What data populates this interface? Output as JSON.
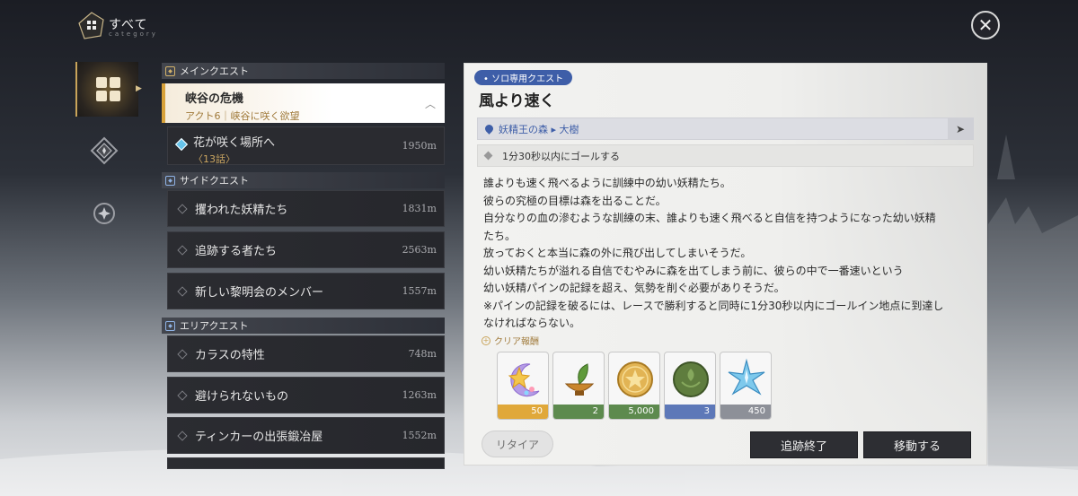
{
  "header": {
    "title": "すべて",
    "subtitle": "category"
  },
  "colors": {
    "accent_gold": "#d8a23a",
    "solo_blue": "#3e5ea8",
    "panel_bg": "#f2f2f0",
    "row_dark": "#2b2c31"
  },
  "sections": {
    "main": {
      "label": "メインクエスト"
    },
    "side": {
      "label": "サイドクエスト"
    },
    "area": {
      "label": "エリアクエスト"
    }
  },
  "main_quest": {
    "title": "峡谷の危機",
    "subtitle": "アクト6｜峡谷に咲く欲望"
  },
  "sub_quest": {
    "title": "花が咲く場所へ",
    "chapter": "〈13話〉",
    "distance": "1950m"
  },
  "side_quests": [
    {
      "title": "攫われた妖精たち",
      "distance": "1831m"
    },
    {
      "title": "追跡する者たち",
      "distance": "2563m"
    },
    {
      "title": "新しい黎明会のメンバー",
      "distance": "1557m"
    }
  ],
  "area_quests": [
    {
      "title": "カラスの特性",
      "distance": "748m"
    },
    {
      "title": "避けられないもの",
      "distance": "1263m"
    },
    {
      "title": "ティンカーの出張鍛冶屋",
      "distance": "1552m"
    }
  ],
  "detail": {
    "badge": "• ソロ専用クエスト",
    "title": "風より速く",
    "location": "妖精王の森 ▸ 大樹",
    "objective": "1分30秒以内にゴールする",
    "description": [
      "誰よりも速く飛べるように訓練中の幼い妖精たち。",
      "彼らの究極の目標は森を出ることだ。",
      "自分なりの血の滲むような訓練の末、誰よりも速く飛べると自信を持つようになった幼い妖精",
      "たち。",
      "放っておくと本当に森の外に飛び出してしまいそうだ。",
      "幼い妖精たちが溢れる自信でむやみに森を出てしまう前に、彼らの中で一番速いという",
      "幼い妖精パインの記録を超え、気勢を削ぐ必要がありそうだ。",
      "※パインの記録を破るには、レースで勝利すると同時に1分30秒以内にゴールイン地点に到達し",
      "なければならない。"
    ],
    "reward_label": "クリア報酬",
    "rewards": [
      {
        "icon": "moon-star-icon",
        "count": "50",
        "tier_color": "#e0a83a"
      },
      {
        "icon": "sprout-bowl-icon",
        "count": "2",
        "tier_color": "#5d8a4e"
      },
      {
        "icon": "gold-coin-icon",
        "count": "5,000",
        "tier_color": "#5d8a4e"
      },
      {
        "icon": "green-seal-icon",
        "count": "3",
        "tier_color": "#5d78b8"
      },
      {
        "icon": "blue-crystal-star-icon",
        "count": "450",
        "tier_color": "#8d9098"
      }
    ],
    "buttons": {
      "retire": "リタイア",
      "stop_tracking": "追跡終了",
      "move": "移動する"
    }
  }
}
